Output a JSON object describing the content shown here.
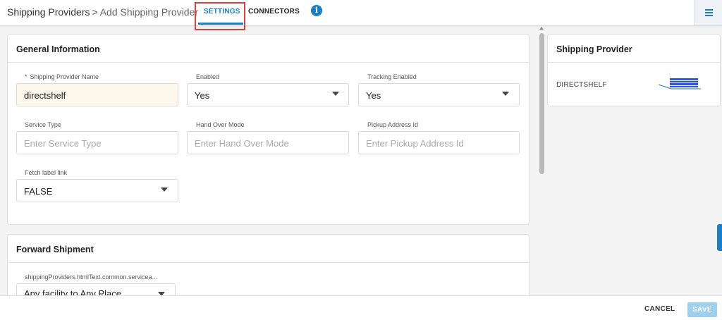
{
  "header": {
    "breadcrumb_root": "Shipping Providers",
    "breadcrumb_sep": ">",
    "breadcrumb_current": "Add Shipping Provider",
    "tabs": [
      {
        "label": "SETTINGS",
        "active": true
      },
      {
        "label": "CONNECTORS",
        "active": false
      }
    ],
    "info_icon": "info-icon",
    "menu_icon": "hamburger-menu-icon",
    "accent_color": "#1a7fc9",
    "highlight_color": "#e23b3b"
  },
  "general": {
    "title": "General Information",
    "fields": {
      "provider_name": {
        "required_mark": "*",
        "label": "Shipping Provider Name",
        "value": "directshelf"
      },
      "enabled": {
        "label": "Enabled",
        "value": "Yes"
      },
      "tracking_enabled": {
        "label": "Tracking Enabled",
        "value": "Yes"
      },
      "service_type": {
        "label": "Service Type",
        "placeholder": "Enter Service Type"
      },
      "hand_over_mode": {
        "label": "Hand Over Mode",
        "placeholder": "Enter Hand Over Mode"
      },
      "pickup_address_id": {
        "label": "Pickup Address Id",
        "placeholder": "Enter Pickup Address Id"
      },
      "fetch_label_link": {
        "label": "Fetch label link",
        "value": "FALSE"
      }
    }
  },
  "forward": {
    "title": "Forward Shipment",
    "service_label": "shippingProviders.htmlText.common.servicea...",
    "service_value": "Any facility to Any Place"
  },
  "provider_panel": {
    "title": "Shipping Provider",
    "name": "DIRECTSHELF"
  },
  "footer": {
    "cancel_label": "CANCEL",
    "save_label": "SAVE",
    "save_color": "#9ecfee"
  }
}
